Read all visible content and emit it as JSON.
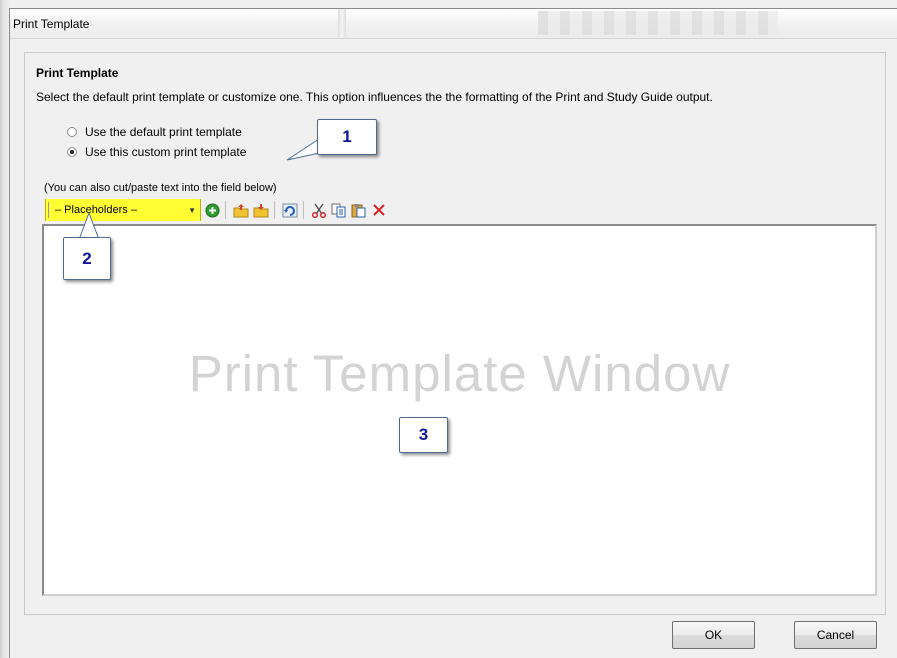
{
  "window": {
    "title": "Print Template"
  },
  "section": {
    "heading": "Print Template",
    "description": "Select the default print template or customize one.  This option influences the the formatting of the Print and Study Guide output."
  },
  "options": [
    {
      "label": "Use the default print template",
      "checked": false
    },
    {
      "label": "Use this custom print template",
      "checked": true
    }
  ],
  "hint": "(You can also cut/paste text into the field below)",
  "toolbar": {
    "placeholder_select": "– Placeholders –",
    "icons": [
      "add-icon",
      "open-folder-icon",
      "save-folder-icon",
      "refresh-icon",
      "cut-icon",
      "copy-icon",
      "paste-icon",
      "delete-icon"
    ]
  },
  "editor": {
    "watermark": "Print Template Window"
  },
  "callouts": [
    "1",
    "2",
    "3"
  ],
  "buttons": {
    "ok": "OK",
    "cancel": "Cancel"
  },
  "colors": {
    "placeholder_bg": "#ffff33",
    "callout_text": "#10149a",
    "watermark": "#d3d3d3"
  }
}
